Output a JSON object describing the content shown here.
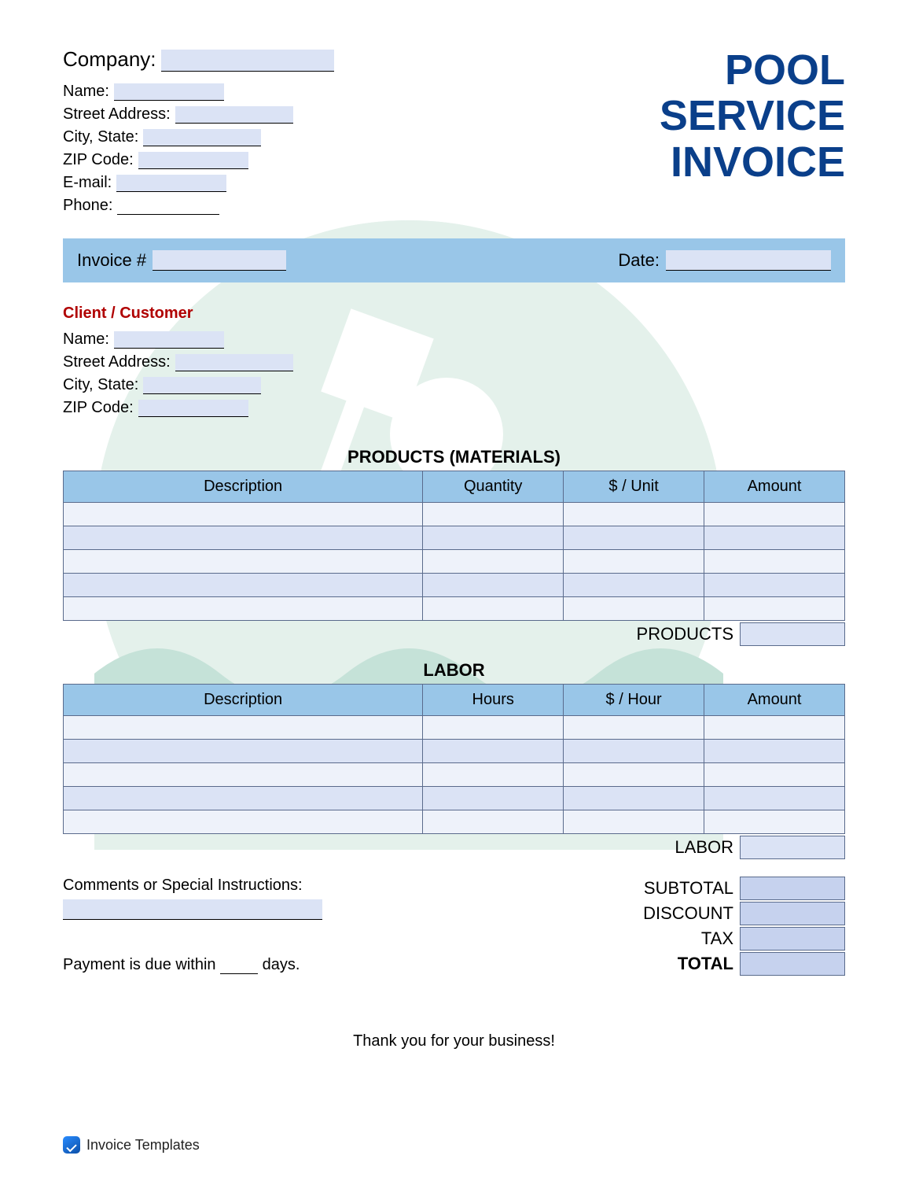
{
  "title_lines": [
    "POOL",
    "SERVICE",
    "INVOICE"
  ],
  "company": {
    "label": "Company:",
    "name_label": "Name:",
    "street_label": "Street Address:",
    "city_state_label": "City, State:",
    "zip_label": "ZIP Code:",
    "email_label": "E-mail:",
    "phone_label": "Phone:",
    "company_value": "",
    "name_value": "",
    "street_value": "",
    "city_state_value": "",
    "zip_value": "",
    "email_value": "",
    "phone_value": ""
  },
  "invoice_bar": {
    "invoice_label": "Invoice #",
    "invoice_value": "",
    "date_label": "Date:",
    "date_value": ""
  },
  "client": {
    "heading": "Client / Customer",
    "name_label": "Name:",
    "street_label": "Street Address:",
    "city_state_label": "City, State:",
    "zip_label": "ZIP Code:",
    "name_value": "",
    "street_value": "",
    "city_state_value": "",
    "zip_value": ""
  },
  "products": {
    "title": "PRODUCTS (MATERIALS)",
    "headers": [
      "Description",
      "Quantity",
      "$ / Unit",
      "Amount"
    ],
    "rows": [
      {
        "description": "",
        "quantity": "",
        "unit": "",
        "amount": ""
      },
      {
        "description": "",
        "quantity": "",
        "unit": "",
        "amount": ""
      },
      {
        "description": "",
        "quantity": "",
        "unit": "",
        "amount": ""
      },
      {
        "description": "",
        "quantity": "",
        "unit": "",
        "amount": ""
      },
      {
        "description": "",
        "quantity": "",
        "unit": "",
        "amount": ""
      }
    ],
    "subtotal_label": "PRODUCTS",
    "subtotal_value": ""
  },
  "labor": {
    "title": "LABOR",
    "headers": [
      "Description",
      "Hours",
      "$ / Hour",
      "Amount"
    ],
    "rows": [
      {
        "description": "",
        "hours": "",
        "rate": "",
        "amount": ""
      },
      {
        "description": "",
        "hours": "",
        "rate": "",
        "amount": ""
      },
      {
        "description": "",
        "hours": "",
        "rate": "",
        "amount": ""
      },
      {
        "description": "",
        "hours": "",
        "rate": "",
        "amount": ""
      },
      {
        "description": "",
        "hours": "",
        "rate": "",
        "amount": ""
      }
    ],
    "subtotal_label": "LABOR",
    "subtotal_value": ""
  },
  "comments": {
    "label": "Comments or Special Instructions:",
    "value": ""
  },
  "payment": {
    "prefix": "Payment is due within",
    "days_value": "",
    "suffix": "days."
  },
  "totals": {
    "subtotal_label": "SUBTOTAL",
    "subtotal_value": "",
    "discount_label": "DISCOUNT",
    "discount_value": "",
    "tax_label": "TAX",
    "tax_value": "",
    "total_label": "TOTAL",
    "total_value": ""
  },
  "thankyou": "Thank you for your business!",
  "footer_brand": "Invoice Templates"
}
